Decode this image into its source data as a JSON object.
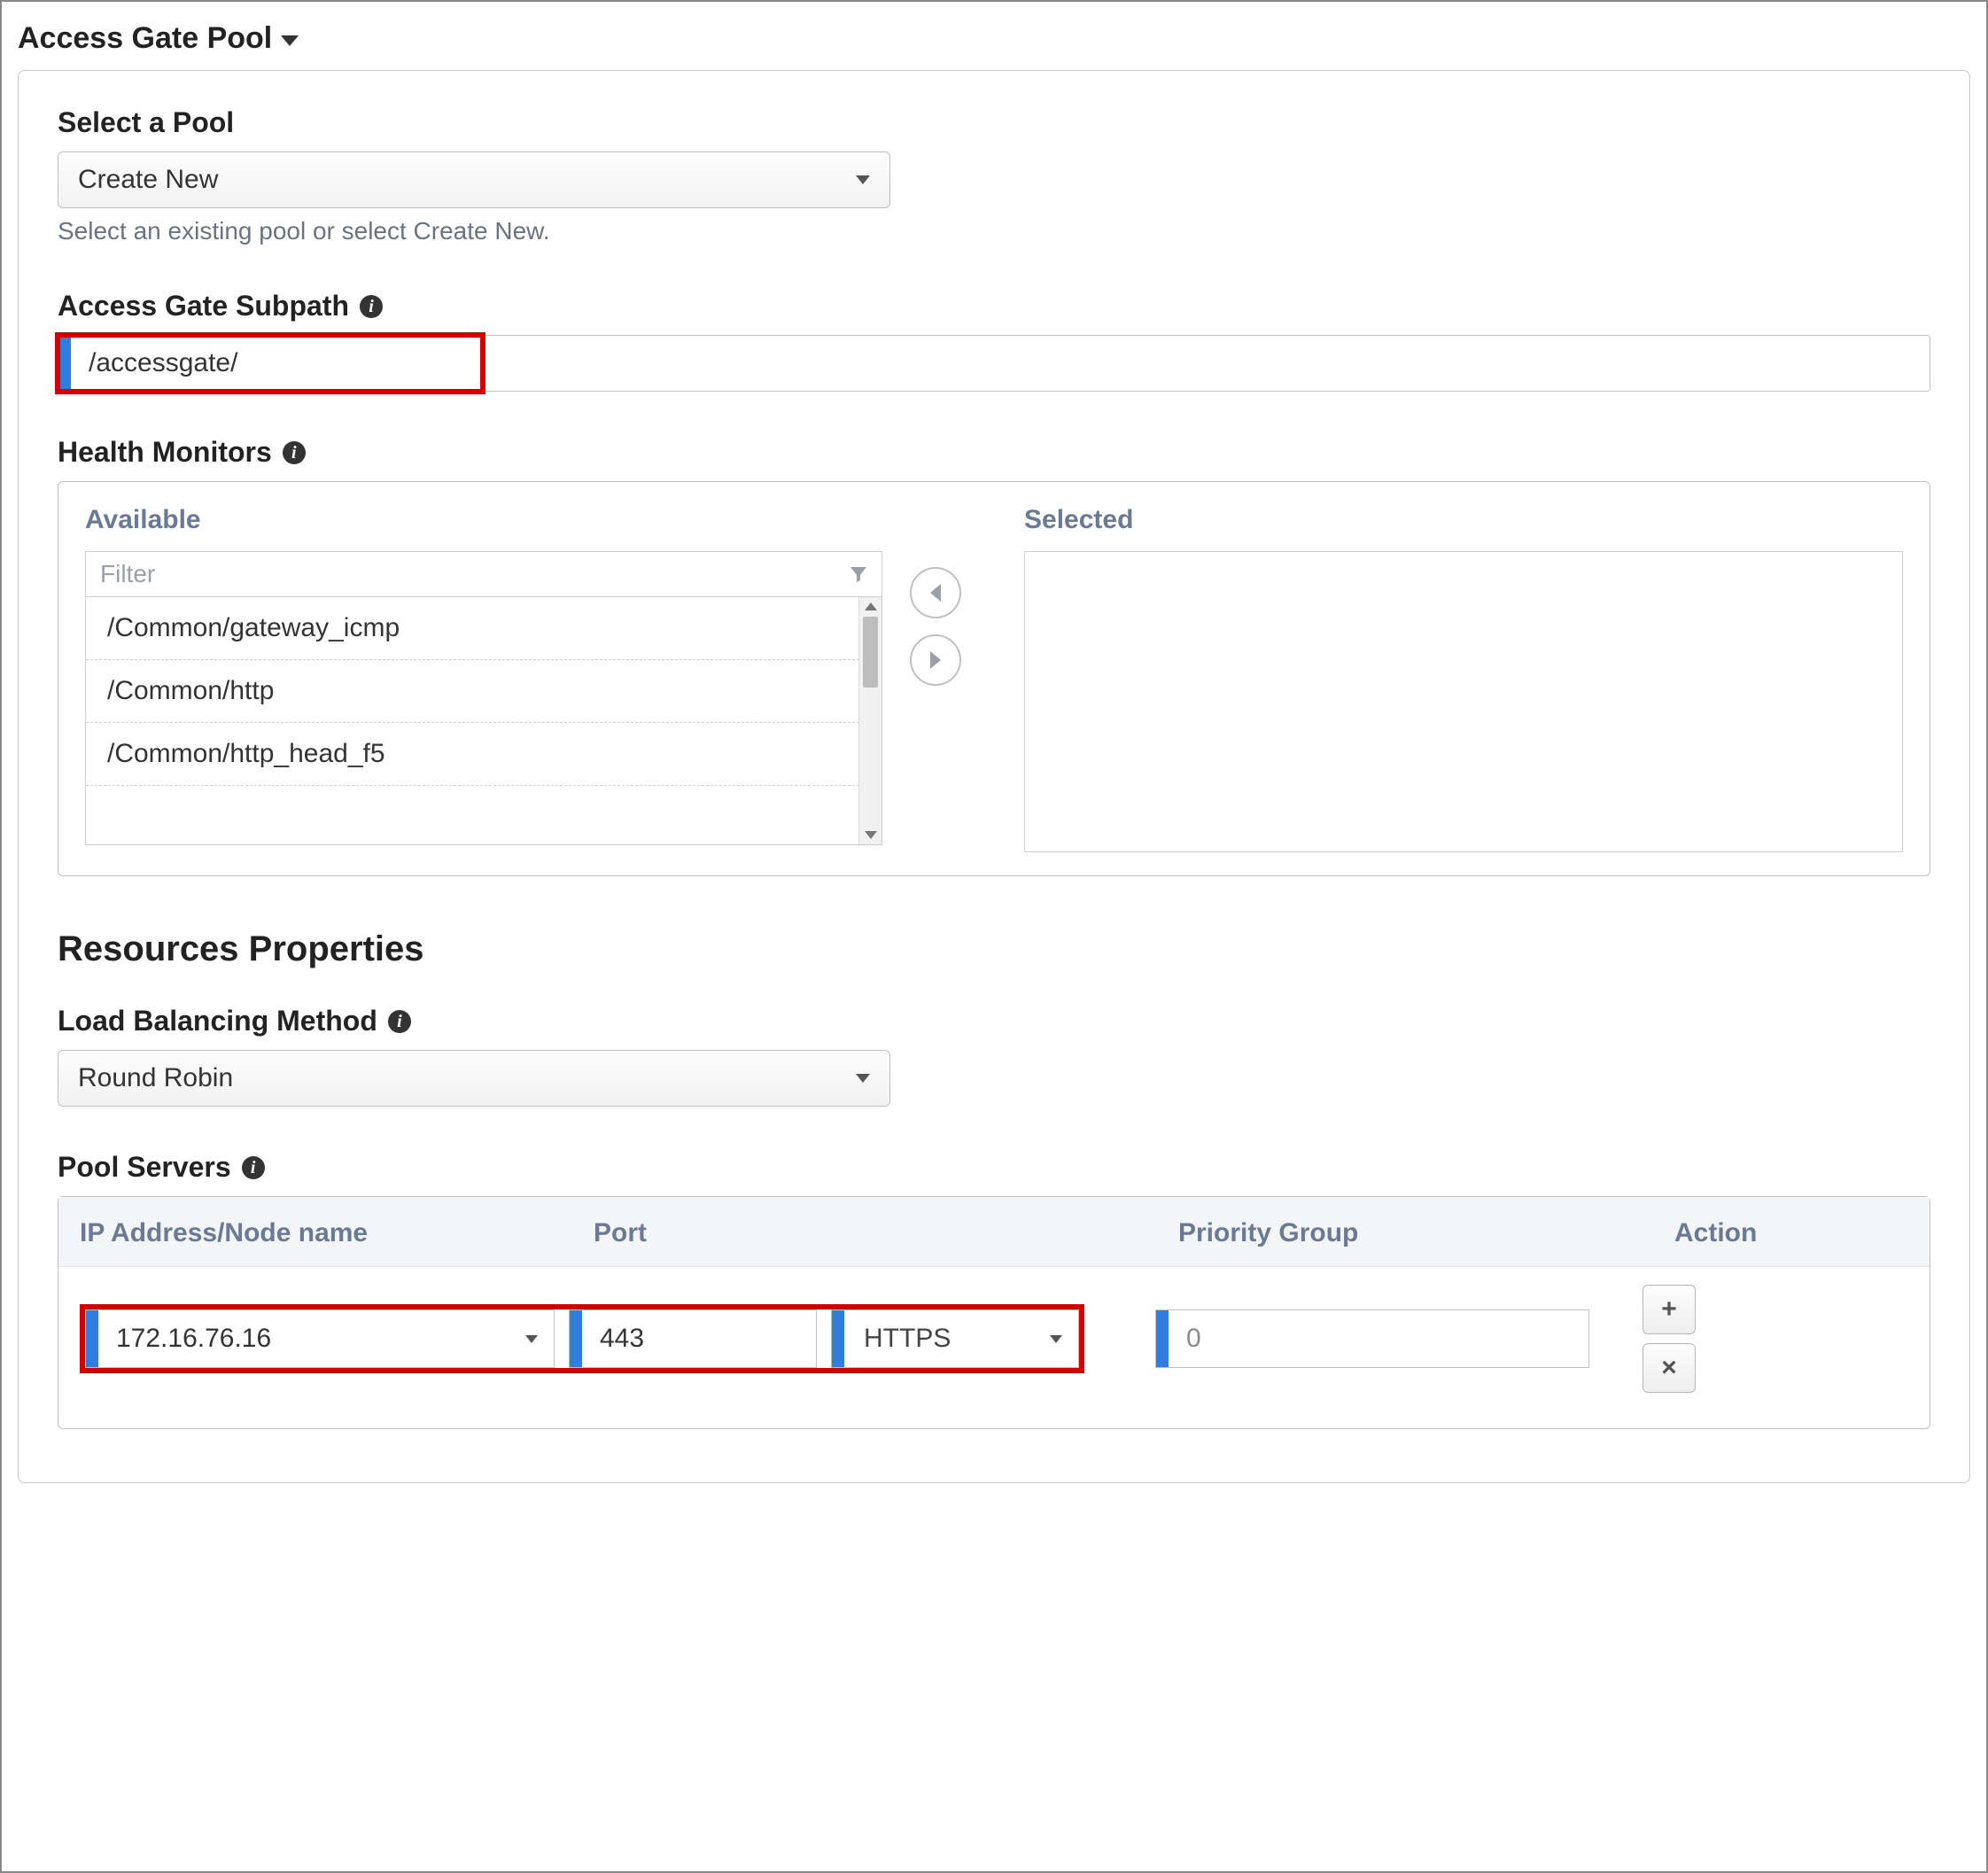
{
  "section_title": "Access Gate Pool",
  "select_pool": {
    "label": "Select a Pool",
    "value": "Create New",
    "helper": "Select an existing pool or select Create New."
  },
  "subpath": {
    "label": "Access Gate Subpath",
    "value": "/accessgate/"
  },
  "health_monitors": {
    "label": "Health Monitors",
    "available_label": "Available",
    "selected_label": "Selected",
    "filter_placeholder": "Filter",
    "items": [
      "/Common/gateway_icmp",
      "/Common/http",
      "/Common/http_head_f5"
    ]
  },
  "resources_heading": "Resources Properties",
  "lb_method": {
    "label": "Load Balancing Method",
    "value": "Round Robin"
  },
  "pool_servers": {
    "label": "Pool Servers",
    "columns": {
      "ip": "IP Address/Node name",
      "port": "Port",
      "priority": "Priority Group",
      "action": "Action"
    },
    "row": {
      "ip": "172.16.76.16",
      "port": "443",
      "protocol": "HTTPS",
      "priority_placeholder": "0"
    },
    "add_label": "+",
    "remove_label": "×"
  }
}
